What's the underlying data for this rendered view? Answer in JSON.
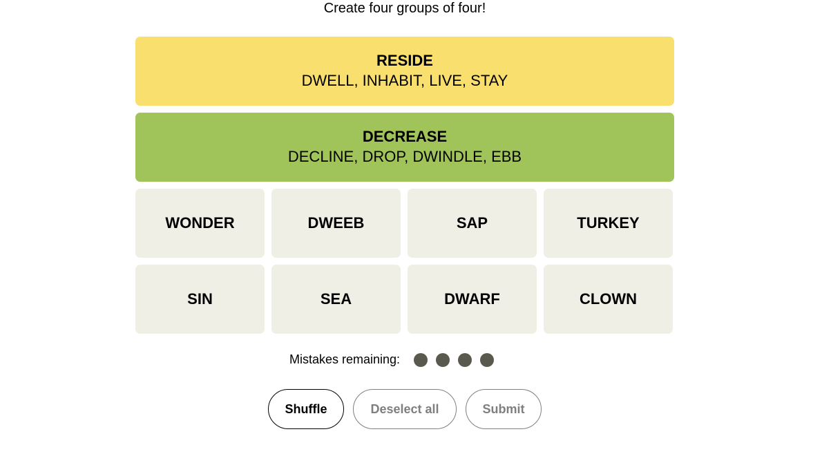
{
  "subtitle": "Create four groups of four!",
  "solved_groups": [
    {
      "category": "RESIDE",
      "words": "DWELL, INHABIT, LIVE, STAY",
      "color": "#f9df6d"
    },
    {
      "category": "DECREASE",
      "words": "DECLINE, DROP, DWINDLE, EBB",
      "color": "#a0c35a"
    }
  ],
  "tiles": [
    "WONDER",
    "DWEEB",
    "SAP",
    "TURKEY",
    "SIN",
    "SEA",
    "DWARF",
    "CLOWN"
  ],
  "mistakes": {
    "label": "Mistakes remaining:",
    "remaining": 4
  },
  "buttons": {
    "shuffle": "Shuffle",
    "deselect": "Deselect all",
    "submit": "Submit"
  }
}
